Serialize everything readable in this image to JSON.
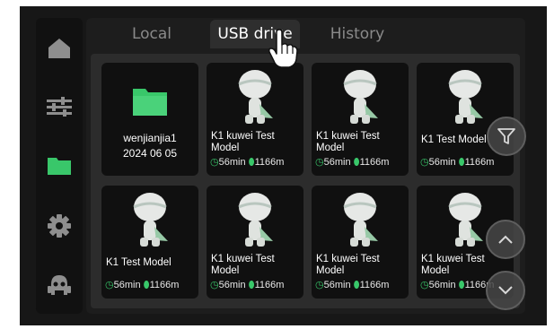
{
  "tabs": [
    {
      "label": "Local",
      "active": false
    },
    {
      "label": "USB drive",
      "active": true
    },
    {
      "label": "History",
      "active": false
    }
  ],
  "sidebar": {
    "items": [
      {
        "icon": "home-icon",
        "active": false
      },
      {
        "icon": "sliders-icon",
        "active": false
      },
      {
        "icon": "folder-icon",
        "active": true
      },
      {
        "icon": "gear-icon",
        "active": false
      },
      {
        "icon": "robot-icon",
        "active": false
      }
    ]
  },
  "files": [
    {
      "type": "folder",
      "name": "wenjianjia1",
      "date": "2024 06 05"
    },
    {
      "type": "model",
      "name": "K1 kuwei Test Model",
      "time": "56min",
      "length": "1166m"
    },
    {
      "type": "model",
      "name": "K1 kuwei Test Model",
      "time": "56min",
      "length": "1166m"
    },
    {
      "type": "model",
      "name": "K1 Test Model",
      "time": "56min",
      "length": "1166m"
    },
    {
      "type": "model",
      "name": "K1 Test Model",
      "time": "56min",
      "length": "1166m"
    },
    {
      "type": "model",
      "name": "K1 kuwei Test Model",
      "time": "56min",
      "length": "1166m"
    },
    {
      "type": "model",
      "name": "K1 kuwei Test Model",
      "time": "56min",
      "length": "1166m"
    },
    {
      "type": "model",
      "name": "K1 kuwei Test Model",
      "time": "56min",
      "length": "1166m"
    }
  ],
  "floating_buttons": [
    "filter-icon",
    "chevron-up-icon",
    "chevron-down-icon"
  ],
  "colors": {
    "accent": "#39c76a",
    "background": "#171717",
    "card": "#101010"
  }
}
